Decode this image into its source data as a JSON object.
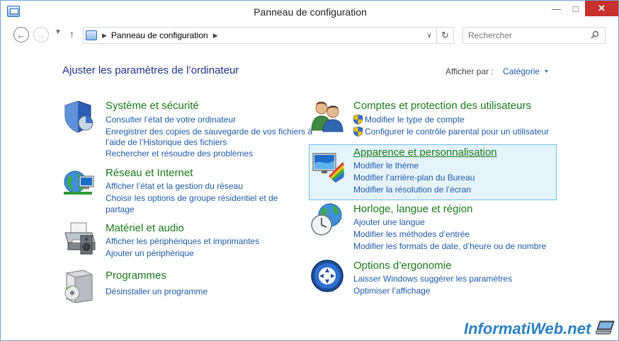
{
  "window": {
    "title": "Panneau de configuration"
  },
  "navbar": {
    "breadcrumb": "Panneau de configuration",
    "search_placeholder": "Rechercher"
  },
  "main": {
    "heading": "Ajuster les paramètres de l’ordinateur",
    "view_by_label": "Afficher par :",
    "view_by_value": "Catégorie"
  },
  "categories": [
    {
      "title": "Système et sécurité",
      "icon": "shield-icon",
      "links": [
        "Consulter l’état de votre ordinateur",
        "Enregistrer des copies de sauvegarde de vos fichiers à",
        "l’aide de l’Historique des fichiers",
        "Rechercher et résoudre des problèmes"
      ]
    },
    {
      "title": "Réseau et Internet",
      "icon": "network-globe-icon",
      "links": [
        "Afficher l’état et la gestion du réseau",
        "Choisir les options de groupe résidentiel et de",
        "partage"
      ]
    },
    {
      "title": "Matériel et audio",
      "icon": "printer-speaker-icon",
      "links": [
        "Afficher les périphériques et imprimantes",
        "Ajouter un périphérique"
      ]
    },
    {
      "title": "Programmes",
      "icon": "programs-box-icon",
      "links": [
        "Désinstaller un programme"
      ]
    },
    {
      "title": "Comptes et protection des utilisateurs",
      "icon": "users-icon",
      "links": [
        "Modifier le type de compte",
        "Configurer le contrôle parental pour un utilisateur"
      ]
    },
    {
      "title": "Apparence et personnalisation",
      "icon": "monitor-palette-icon",
      "links": [
        "Modifier le thème",
        "Modifier l’arrière-plan du Bureau",
        "Modifier la résolution de l’écran"
      ]
    },
    {
      "title": "Horloge, langue et région",
      "icon": "clock-globe-icon",
      "links": [
        "Ajouter une langue",
        "Modifier les méthodes d’entrée",
        "Modifier les formats de date, d’heure ou de nombre"
      ]
    },
    {
      "title": "Options d’ergonomie",
      "icon": "ease-of-access-icon",
      "links": [
        "Laisser Windows suggérer les paramètres",
        "Optimiser l’affichage"
      ]
    }
  ],
  "watermark": "InformatiWeb.net",
  "colors": {
    "link": "#1e5aa8",
    "category_title": "#1a7a1a",
    "heading": "#1e3287",
    "highlight_bg": "#e5f3fb",
    "highlight_border": "#70c0e7",
    "close_button": "#c7312b"
  }
}
